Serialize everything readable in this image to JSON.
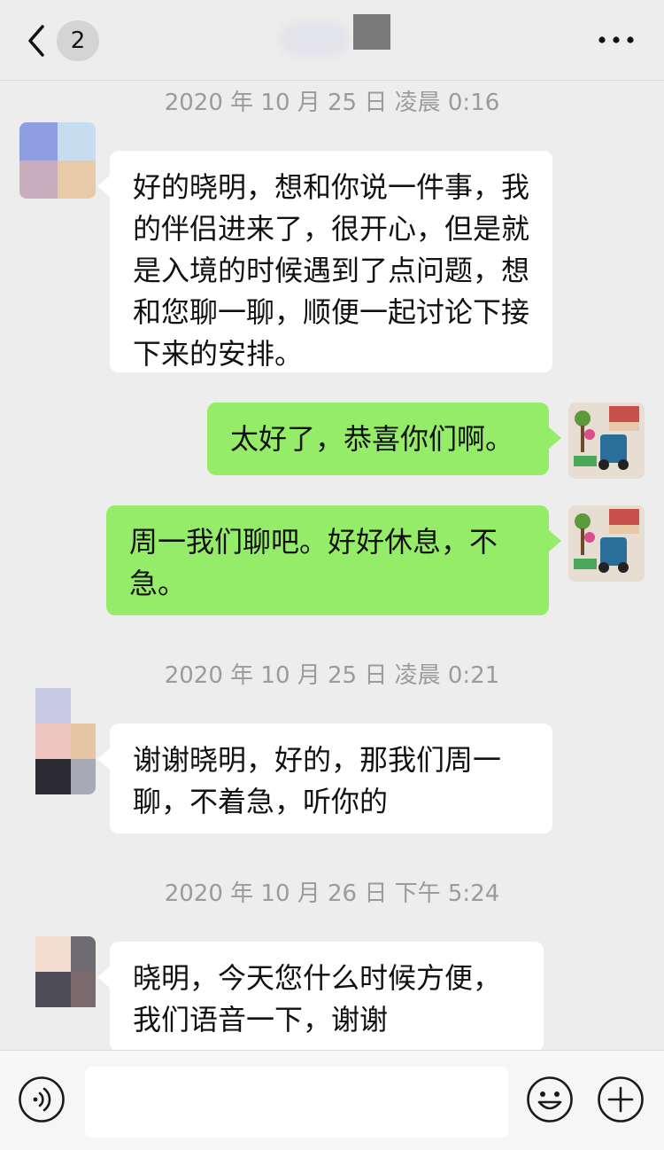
{
  "header": {
    "back_badge": "2",
    "more_label": "···",
    "icons": {
      "back": "chevron-left-icon",
      "more": "more-dots-icon"
    }
  },
  "messages": [
    {
      "type": "timestamp",
      "text": "2020 年 10 月 25 日 凌晨 0:16"
    },
    {
      "type": "incoming",
      "text": "好的晓明，想和你说一件事，我的伴侣进来了，很开心，但是就是入境的时候遇到了点问题，想和您聊一聊，顺便一起讨论下接下来的安排。"
    },
    {
      "type": "outgoing",
      "text": "太好了，恭喜你们啊。"
    },
    {
      "type": "outgoing",
      "text": "周一我们聊吧。好好休息，不急。"
    },
    {
      "type": "timestamp",
      "text": "2020 年 10 月 25 日 凌晨 0:21"
    },
    {
      "type": "incoming",
      "text": "谢谢晓明，好的，那我们周一聊，不着急，听你的"
    },
    {
      "type": "timestamp",
      "text": "2020 年 10 月 26 日 下午 5:24"
    },
    {
      "type": "incoming",
      "text": "晓明，今天您什么时候方便，我们语音一下，谢谢"
    }
  ],
  "input_bar": {
    "input_value": "",
    "icons": {
      "voice": "voice-icon",
      "emoji": "emoji-icon",
      "plus": "plus-icon"
    }
  },
  "colors": {
    "background": "#ededed",
    "incoming_bubble": "#ffffff",
    "outgoing_bubble": "#95ec69",
    "timestamp_text": "#9b9b9b"
  }
}
